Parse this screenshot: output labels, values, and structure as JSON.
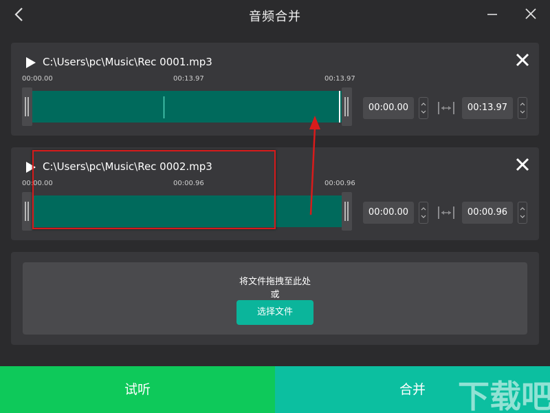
{
  "window": {
    "title": "音频合并",
    "back_icon": "chevron-left-icon",
    "minimize_icon": "minimize-icon",
    "close_icon": "close-icon"
  },
  "tracks": [
    {
      "file_name": "C:\\Users\\pc\\Music\\Rec 0001.mp3",
      "ticks": [
        "00:00.00",
        "00:13.97",
        "00:13.97"
      ],
      "start_time": "00:00.00",
      "end_time": "00:13.97"
    },
    {
      "file_name": "C:\\Users\\pc\\Music\\Rec 0002.mp3",
      "ticks": [
        "00:00.00",
        "00:00.96",
        "00:00.96"
      ],
      "start_time": "00:00.00",
      "end_time": "00:00.96"
    }
  ],
  "drop_zone": {
    "hint": "将文件拖拽至此处",
    "or_text": "或",
    "choose_button": "选择文件"
  },
  "actions": {
    "preview": "试听",
    "merge": "合并"
  },
  "colors": {
    "background": "#2b2b2d",
    "card": "#38383b",
    "waveform": "#006a5c",
    "preview_button": "#0ec95a",
    "merge_button": "#0cbfa0",
    "accent_button": "#0bb59b",
    "annotation": "#d81b1b"
  },
  "watermark": "下载吧"
}
